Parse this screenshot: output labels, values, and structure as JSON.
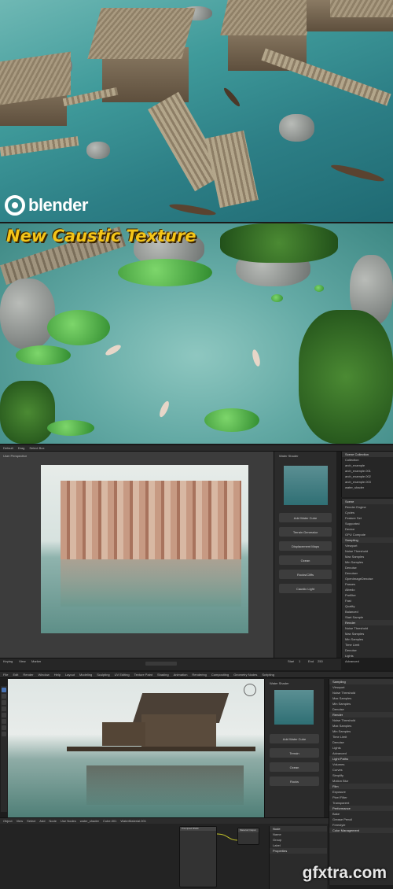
{
  "panel1": {
    "logo_text": "blender"
  },
  "panel2": {
    "title": "New Caustic Texture"
  },
  "panel3": {
    "topbar_items": [
      "Default",
      "Drag",
      "Select Box"
    ],
    "viewport_label": "User Perspective",
    "npanel_title": "Water Shader",
    "npanel_buttons": [
      "Add Water Cube",
      "Terrain Generator",
      "Displacement Maps",
      "Ocean",
      "Rocks/Cliffs",
      "Caustic Light"
    ],
    "outliner_title": "Scene Collection",
    "outliner_items": [
      "Collection",
      "arch_example",
      "arch_example.001",
      "arch_example.002",
      "arch_example.003",
      "water_shader"
    ],
    "props_rows": [
      "Scene",
      "Render Engine",
      "Cycles",
      "Feature Set",
      "Supported",
      "Device",
      "GPU Compute",
      "Sampling",
      "Viewport",
      "Noise Threshold",
      "Max Samples",
      "Min Samples",
      "Denoise",
      "Denoiser",
      "OpenImageDenoise",
      "Passes",
      "Albedo",
      "Prefilter",
      "Fast",
      "Quality",
      "Balanced",
      "Start Sample",
      "Render",
      "Noise Threshold",
      "Max Samples",
      "Min Samples",
      "Time Limit",
      "Denoise",
      "Lights",
      "Advanced"
    ],
    "timeline_items": [
      "Keying",
      "View",
      "Marker",
      "Start",
      "1",
      "End",
      "250"
    ]
  },
  "panel4": {
    "topbar_items": [
      "File",
      "Edit",
      "Render",
      "Window",
      "Help",
      "Layout",
      "Modeling",
      "Sculpting",
      "UV Editing",
      "Texture Paint",
      "Shading",
      "Animation",
      "Rendering",
      "Compositing",
      "Geometry Nodes",
      "Scripting"
    ],
    "npanel_title": "Water Shader",
    "npanel_buttons": [
      "Add Water Cube",
      "Terrain",
      "Ocean",
      "Rocks"
    ],
    "props_rows": [
      "Sampling",
      "Viewport",
      "Noise Threshold",
      "Max Samples",
      "Min Samples",
      "Denoise",
      "Render",
      "Noise Threshold",
      "Max Samples",
      "Min Samples",
      "Time Limit",
      "Denoise",
      "Lights",
      "Advanced",
      "Light Paths",
      "Volumes",
      "Curves",
      "Simplify",
      "Motion Blur",
      "Film",
      "Exposure",
      "Pixel Filter",
      "Transparent",
      "Performance",
      "Bake",
      "Grease Pencil",
      "Freestyle",
      "Color Management"
    ],
    "node_editor_items": [
      "Object",
      "View",
      "Select",
      "Add",
      "Node",
      "Use Nodes",
      "water_shader",
      "Cube.001",
      "WaterMaterial.001"
    ],
    "node_names": [
      "Principled BSDF",
      "Material Output",
      "Group"
    ],
    "side_props": [
      "Node",
      "Name",
      "Group",
      "Label",
      "Properties"
    ]
  },
  "watermark": "gfxtra.com",
  "colors": {
    "title_yellow": "#f4c518",
    "blender_blue": "#4772b3"
  }
}
